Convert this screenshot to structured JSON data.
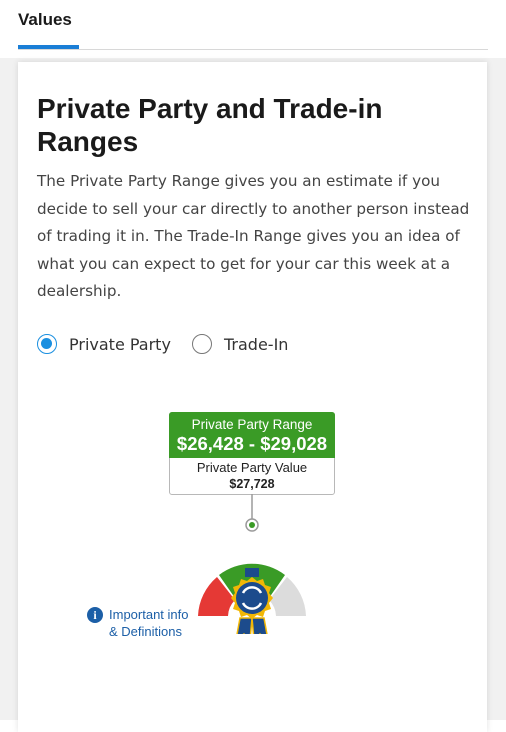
{
  "tabs": {
    "values_label": "Values"
  },
  "card": {
    "title": "Private Party and Trade-in Ranges",
    "description": "The Private Party Range gives you an estimate if you decide to sell your car directly to another person instead of trading it in. The Trade-In Range gives you an idea of what you can expect to get for your car this week at a dealership."
  },
  "radios": {
    "options": [
      {
        "label": "Private Party",
        "selected": true
      },
      {
        "label": "Trade-In",
        "selected": false
      }
    ]
  },
  "range": {
    "header_label": "Private Party Range",
    "header_value": "$26,428 - $29,028",
    "value_label": "Private Party Value",
    "value": "$27,728"
  },
  "gauge": {
    "icon": "kbb-ribbon-badge-icon",
    "colors": {
      "low": "#e53935",
      "mid": "#3a9b26",
      "high": "#d9d9d9",
      "badge": "#1c4b8c",
      "ribbon": "#f2b705"
    }
  },
  "info": {
    "icon": "info-icon",
    "label": "Important info\n& Definitions"
  },
  "colors": {
    "accent": "#1a7ed6",
    "radio_selected": "#1a8fe0",
    "range_green": "#3a9b26",
    "link": "#1c5fa7"
  }
}
